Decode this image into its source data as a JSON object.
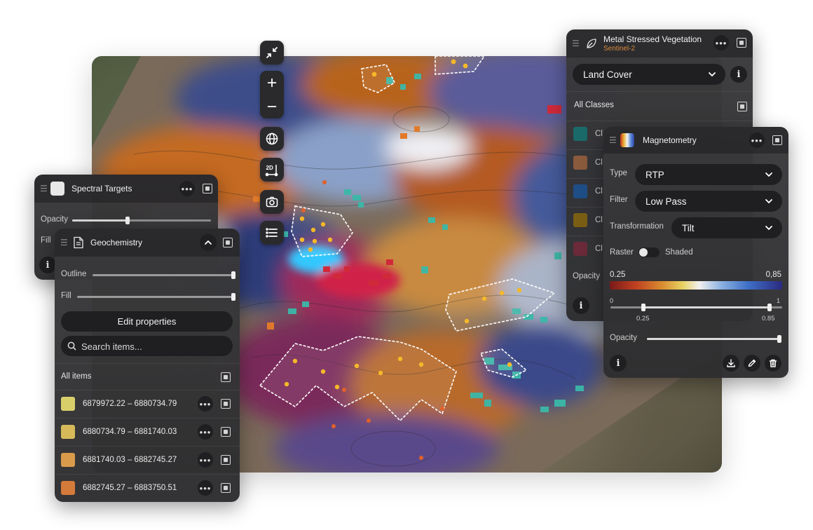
{
  "map": {
    "tools": [
      {
        "name": "collapse",
        "icon": "collapse-arrows-icon"
      },
      {
        "name": "zoom-in",
        "icon": "plus-icon",
        "label": "+"
      },
      {
        "name": "zoom-out",
        "icon": "minus-icon",
        "label": "−"
      },
      {
        "name": "globe",
        "icon": "globe-icon"
      },
      {
        "name": "view-2d",
        "icon": "2d-icon",
        "label": "2D"
      },
      {
        "name": "camera",
        "icon": "camera-icon"
      },
      {
        "name": "layers-list",
        "icon": "list-icon"
      }
    ]
  },
  "spectral": {
    "title": "Spectral Targets",
    "opacity_label": "Opacity",
    "opacity_value": 0.4,
    "fill_label": "Fill"
  },
  "geochem": {
    "title": "Geochemistry",
    "outline_label": "Outline",
    "fill_label": "Fill",
    "edit_label": "Edit properties",
    "search_placeholder": "Search items...",
    "all_items_label": "All items",
    "items": [
      {
        "range": "6879972.22 – 6880734.79",
        "color": "#d9cf6a"
      },
      {
        "range": "6880734.79 – 6881740.03",
        "color": "#d7b95a"
      },
      {
        "range": "6881740.03 – 6882745.27",
        "color": "#d99a4b"
      },
      {
        "range": "6882745.27 – 6883750.51",
        "color": "#d47a3a"
      }
    ]
  },
  "vegetation": {
    "title": "Metal Stressed Vegetation",
    "subtitle": "Sentinel-2",
    "dropdown_value": "Land Cover",
    "all_classes_label": "All Classes",
    "opacity_label": "Opacity",
    "classes": [
      {
        "label": "Cl",
        "color": "#1a6a6a"
      },
      {
        "label": "Cl",
        "color": "#8a5a3c"
      },
      {
        "label": "Cl",
        "color": "#1f4e86"
      },
      {
        "label": "Cl",
        "color": "#7a5e14"
      },
      {
        "label": "Cl",
        "color": "#6a2a3a"
      }
    ]
  },
  "magneto": {
    "title": "Magnetometry",
    "type_label": "Type",
    "type_value": "RTP",
    "filter_label": "Filter",
    "filter_value": "Low Pass",
    "transformation_label": "Transformation",
    "transformation_value": "Tilt",
    "raster_label": "Raster",
    "shaded_label": "Shaded",
    "range_min": "0.25",
    "range_max": "0,85",
    "slider_min": "0",
    "slider_max": "1",
    "slider_low": "0.25",
    "slider_high": "0.85",
    "opacity_label": "Opacity",
    "opacity_value": 1.0
  }
}
